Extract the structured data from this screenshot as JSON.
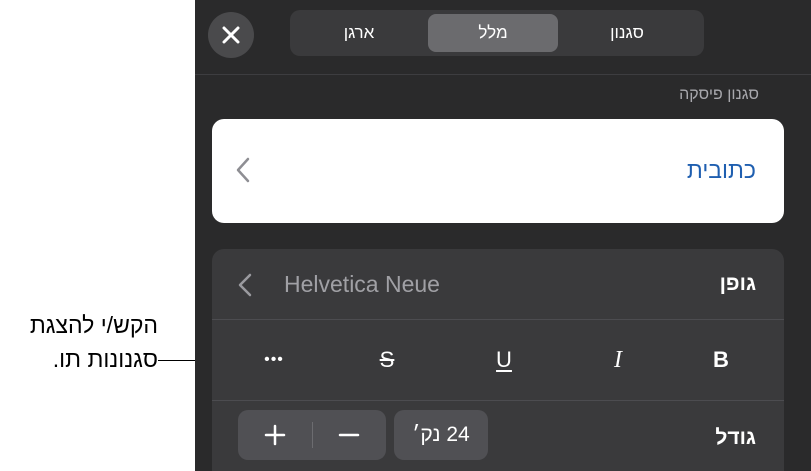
{
  "callout": {
    "line1": "הקש/י להצגת",
    "line2": "סגנונות תו."
  },
  "tabs": [
    {
      "label": "ארגן",
      "selected": false
    },
    {
      "label": "מלל",
      "selected": true
    },
    {
      "label": "סגנון",
      "selected": false
    }
  ],
  "paragraph_style": {
    "section_label": "סגנון פיסקה",
    "value": "כתובית"
  },
  "font": {
    "label": "גופן",
    "name": "Helvetica Neue"
  },
  "format_buttons": {
    "bold": "B",
    "italic": "I",
    "underline": "U",
    "strikethrough": "S",
    "more": "•••"
  },
  "size": {
    "label": "גודל",
    "value": "24 נק׳"
  },
  "icons": {
    "close": "close-icon",
    "chevron": "chevron-left-icon",
    "plus": "plus-icon",
    "minus": "minus-icon"
  }
}
